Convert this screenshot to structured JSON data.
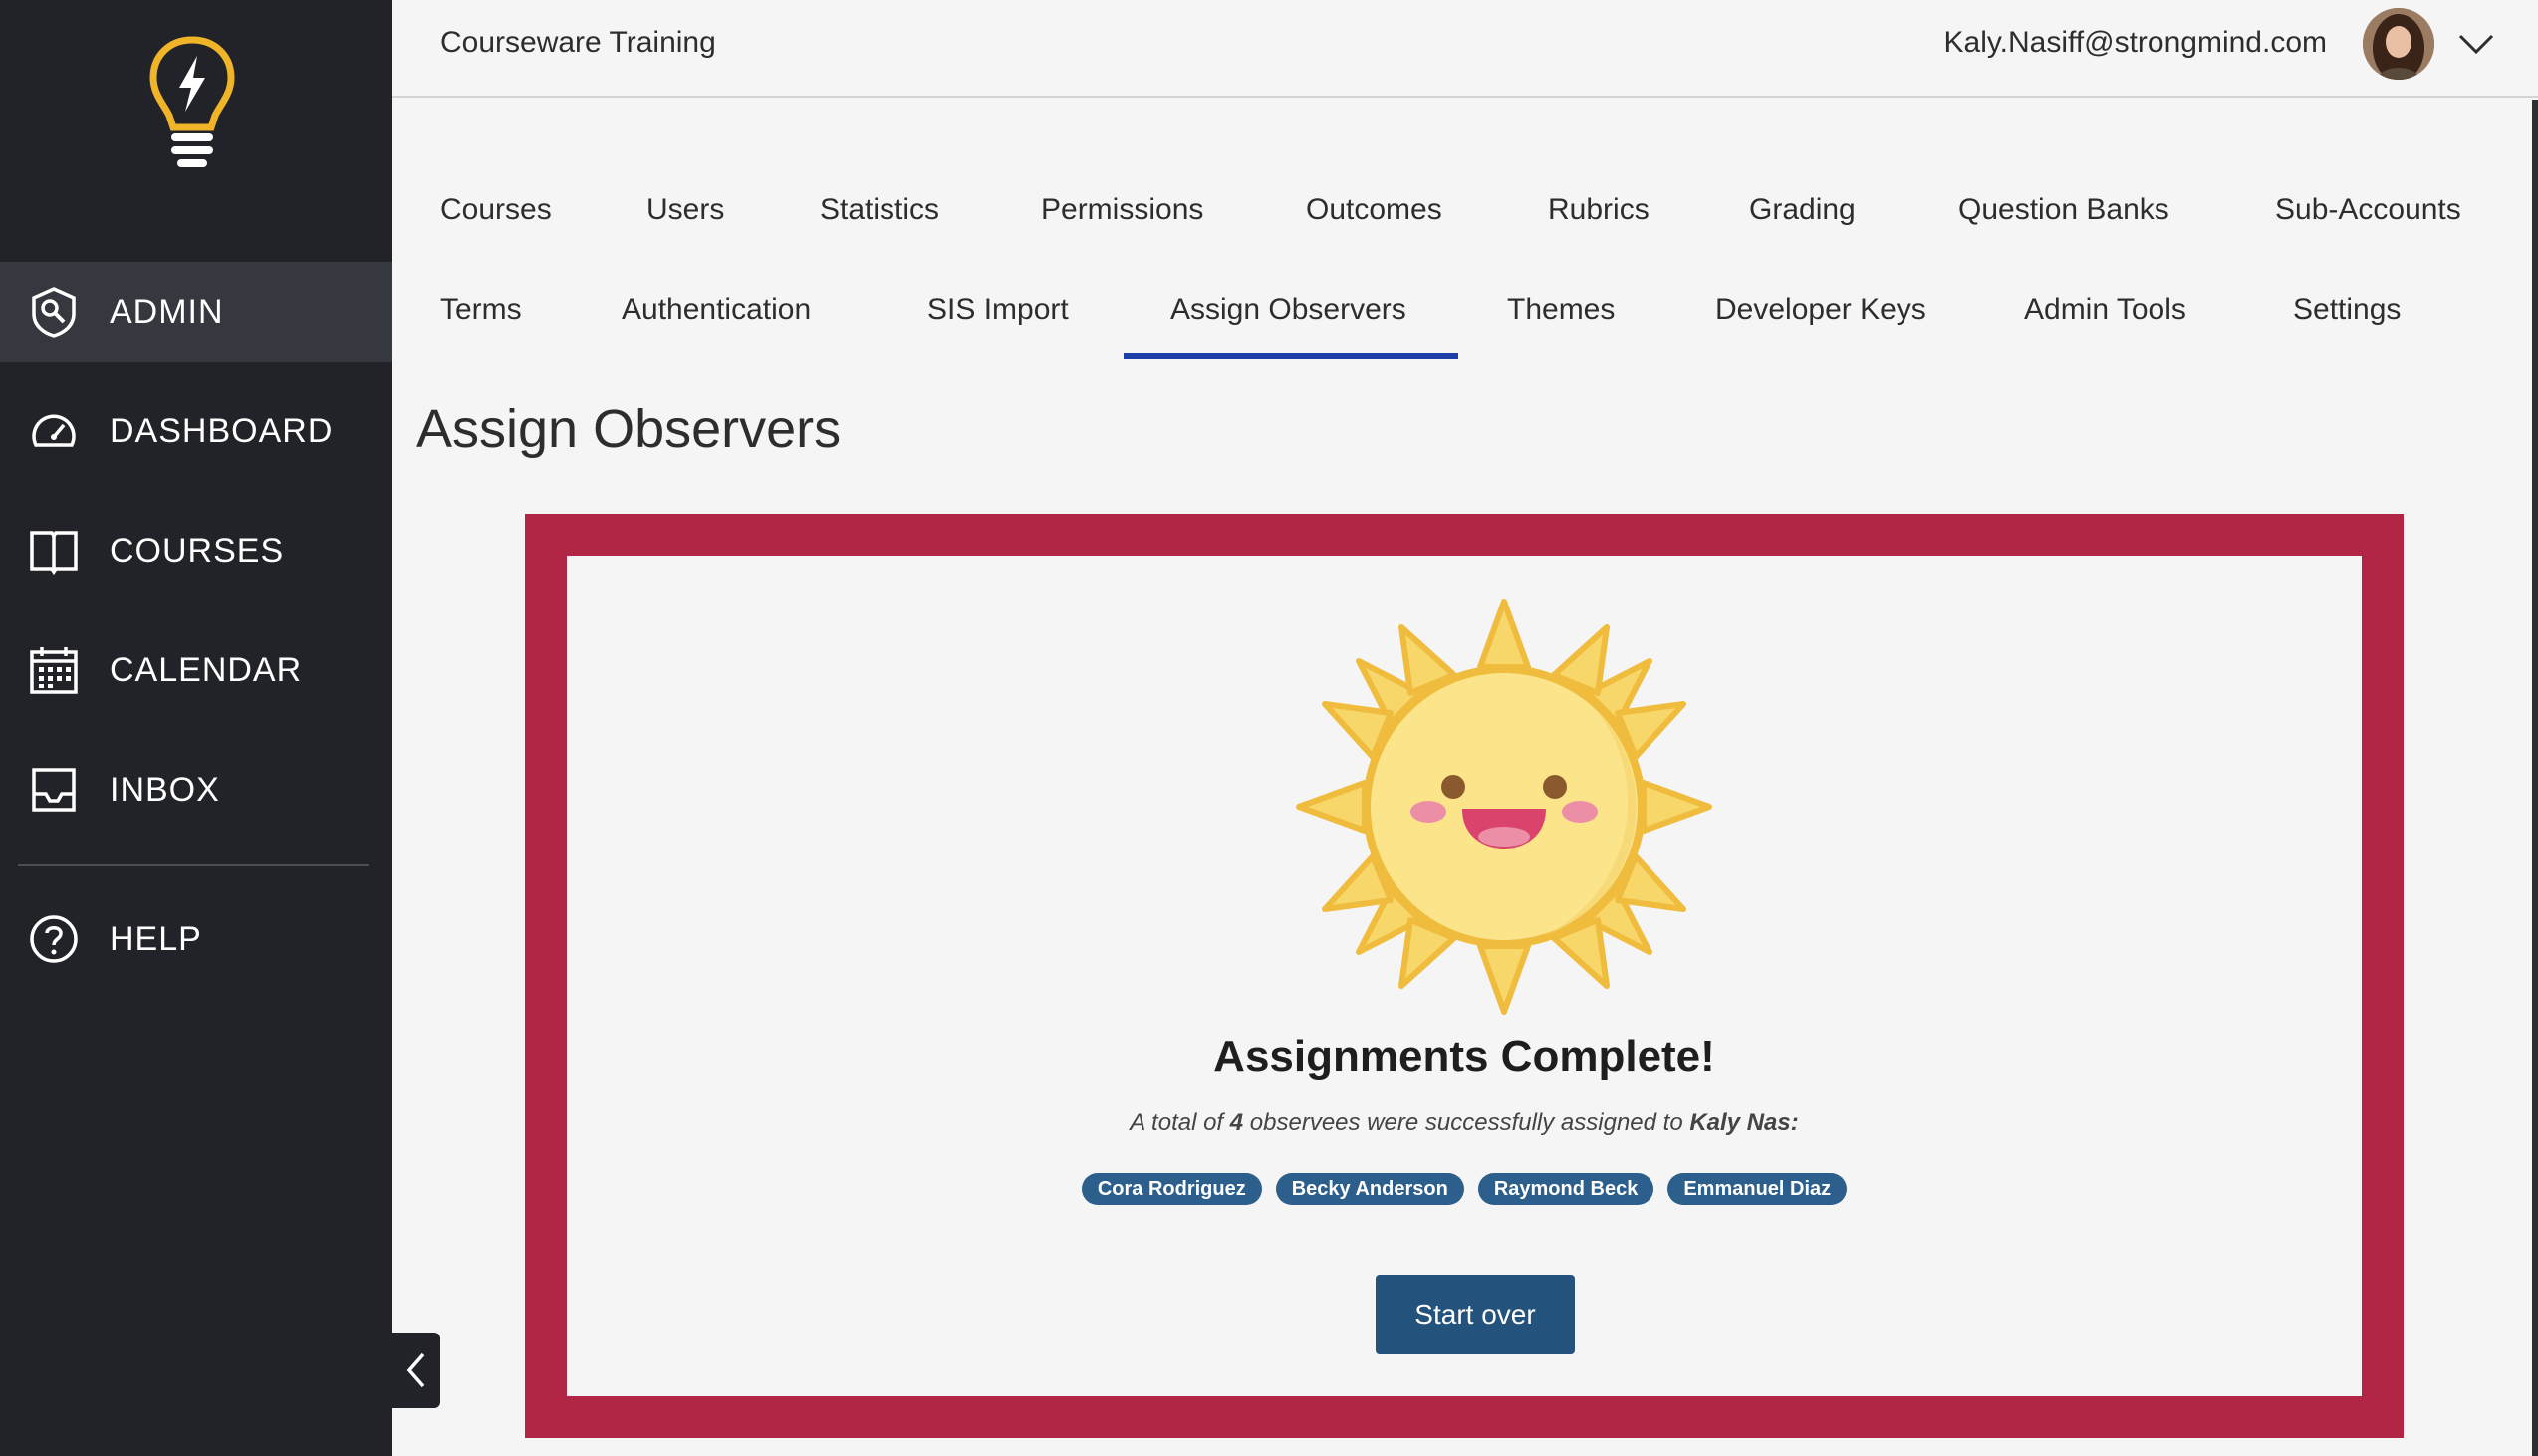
{
  "sidebar": {
    "items": [
      {
        "label": "ADMIN",
        "icon": "admin-shield-icon",
        "active": true
      },
      {
        "label": "DASHBOARD",
        "icon": "speedometer-icon",
        "active": false
      },
      {
        "label": "COURSES",
        "icon": "book-icon",
        "active": false
      },
      {
        "label": "CALENDAR",
        "icon": "calendar-icon",
        "active": false
      },
      {
        "label": "INBOX",
        "icon": "inbox-icon",
        "active": false
      },
      {
        "label": "HELP",
        "icon": "help-icon",
        "active": false
      }
    ]
  },
  "header": {
    "org_name": "Courseware Training",
    "user_email": "Kaly.Nasiff@strongmind.com"
  },
  "tabs": {
    "row1": [
      "Courses",
      "Users",
      "Statistics",
      "Permissions",
      "Outcomes",
      "Rubrics",
      "Grading",
      "Question Banks",
      "Sub-Accounts"
    ],
    "row2": [
      "Terms",
      "Authentication",
      "SIS Import",
      "Assign Observers",
      "Themes",
      "Developer Keys",
      "Admin Tools",
      "Settings"
    ],
    "active": "Assign Observers"
  },
  "page": {
    "title": "Assign Observers"
  },
  "result": {
    "heading": "Assignments Complete!",
    "subtext_prefix": "A total of ",
    "count": "4",
    "subtext_middle": " observees were successfully assigned to ",
    "assignee": "Kaly Nas:",
    "observees": [
      "Cora Rodriguez",
      "Becky Anderson",
      "Raymond Beck",
      "Emmanuel Diaz"
    ],
    "button_label": "Start over"
  },
  "colors": {
    "sidebar_bg": "#212328",
    "active_tab_underline": "#1f3fa8",
    "frame": "#b12644",
    "pill": "#2d5f8c",
    "button": "#23527c",
    "logo": "#f0b429"
  }
}
